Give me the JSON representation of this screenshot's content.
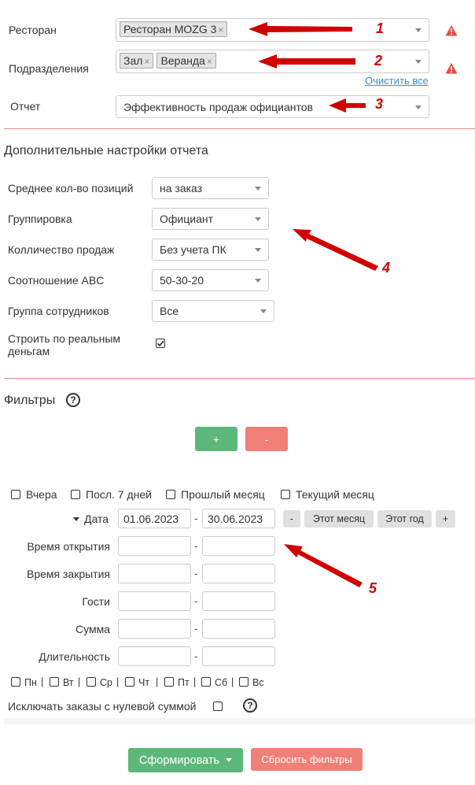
{
  "report": {
    "restaurant_label": "Ресторан",
    "restaurant_tag": "Ресторан MOZG 3",
    "divisions_label": "Подразделения",
    "divisions_tags": [
      "Зал",
      "Веранда"
    ],
    "clear_all": "Очистить все",
    "report_label": "Отчет",
    "report_value": "Эффективность продаж официантов"
  },
  "extra": {
    "title": "Дополнительные настройки отчета",
    "avg_label": "Среднее кол-во позиций",
    "avg_value": "на заказ",
    "group_label": "Группировка",
    "group_value": "Официант",
    "count_label": "Колличество продаж",
    "count_value": "Без учета ПК",
    "abc_label": "Соотношение ABC",
    "abc_value": "50-30-20",
    "staff_label": "Группа сотрудников",
    "staff_value": "Все",
    "real_money_line1": "Строить по реальным",
    "real_money_line2": "деньгам",
    "real_money_checked": true
  },
  "filters": {
    "title": "Фильтры",
    "help_glyph": "?",
    "add_label": "+",
    "remove_label": "-",
    "periods": [
      "Вчера",
      "Посл. 7 дней",
      "Прошлый месяц",
      "Текущий месяц"
    ],
    "date_label": "Дата",
    "date_from": "01.06.2023",
    "date_to": "30.06.2023",
    "dash": "-",
    "minus_label": "-",
    "this_month": "Этот месяц",
    "this_year": "Этот год",
    "plus_label": "+",
    "open_time": "Время открытия",
    "close_time": "Время закрытия",
    "guests": "Гости",
    "sum": "Сумма",
    "duration": "Длительность",
    "days": [
      "Пн",
      "Вт",
      "Ср",
      "Чт",
      "Пт",
      "Сб",
      "Вс"
    ],
    "day_sep": "|",
    "exclude_zero": "Исключать заказы с нулевой суммой"
  },
  "actions": {
    "generate": "Сформировать",
    "reset": "Сбросить фильтры"
  },
  "annotations": [
    "1",
    "2",
    "3",
    "4",
    "5"
  ],
  "colors": {
    "accent_green": "#5cb87a",
    "accent_red": "#f07f77",
    "divider": "#e48a85",
    "warning": "#e74c3c",
    "annotation": "#d10000"
  }
}
